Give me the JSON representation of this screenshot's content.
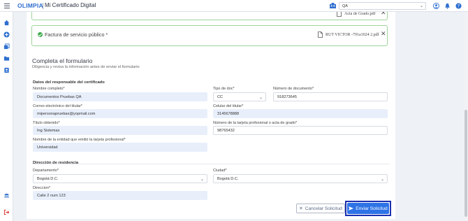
{
  "header": {
    "logo": "OLIMPIA",
    "app_title": "Mi Certificado Digital",
    "env_value": "QA"
  },
  "files": {
    "top_file_name": "Acta de Grado.pdf",
    "main_label": "Factura de servicio público *",
    "main_file_name": "RUT VICTOR -791a1024 2.pdf"
  },
  "form": {
    "title": "Completa el formulario",
    "subtitle": "Diligencia y revisa la información antes de enviar el formulario",
    "responsible": {
      "title": "Datos del responsable del certificado",
      "full_name_label": "Nombre completo*",
      "full_name": "Documentos Pruebas QA",
      "doc_type_label": "Tipo de doc*",
      "doc_type": "CC",
      "doc_number_label": "Número de documento*",
      "doc_number": "918273645",
      "email_label": "Correo electrónico del titular*",
      "email": "mipersonapruebas@yopmail.com",
      "phone_label": "Celular del titular*",
      "phone": "3145678888",
      "degree_label": "Título obtenido*",
      "degree": "Ing Sistemas",
      "card_number_label": "Número de la tarjeta profesional o acta de grado*",
      "card_number": "98765432",
      "entity_label": "Nombre de la entidad que emitió la tarjeta profesional*",
      "entity": "Universidad"
    },
    "residence": {
      "title": "Dirección de residencia",
      "department_label": "Departamento*",
      "department": "Bogotá D.C.",
      "city_label": "Ciudad*",
      "city": "Bogotá D.C.",
      "address_label": "Direccion*",
      "address": "Calle 2 num 123"
    },
    "buttons": {
      "cancel": "Cancelar Solicitud",
      "send": "Enviar Solicitud"
    }
  },
  "colors": {
    "primary": "#2e73e6",
    "success": "#3aa84a",
    "focus_outline": "#1b2fb0"
  }
}
